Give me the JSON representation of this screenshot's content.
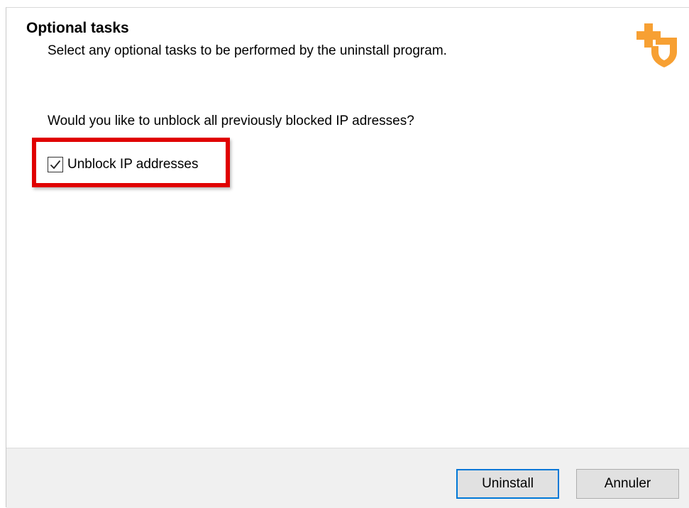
{
  "header": {
    "title": "Optional tasks",
    "subtitle": "Select any optional tasks to be performed by the uninstall program.",
    "logo_icon": "shield-plus-icon",
    "logo_color": "#f7a033"
  },
  "content": {
    "question": "Would you like to unblock all previously blocked IP adresses?",
    "checkbox": {
      "label": "Unblock IP addresses",
      "checked": true
    },
    "highlight_color": "#e00000"
  },
  "footer": {
    "uninstall_label": "Uninstall",
    "cancel_label": "Annuler",
    "primary_border_color": "#0078d7"
  }
}
